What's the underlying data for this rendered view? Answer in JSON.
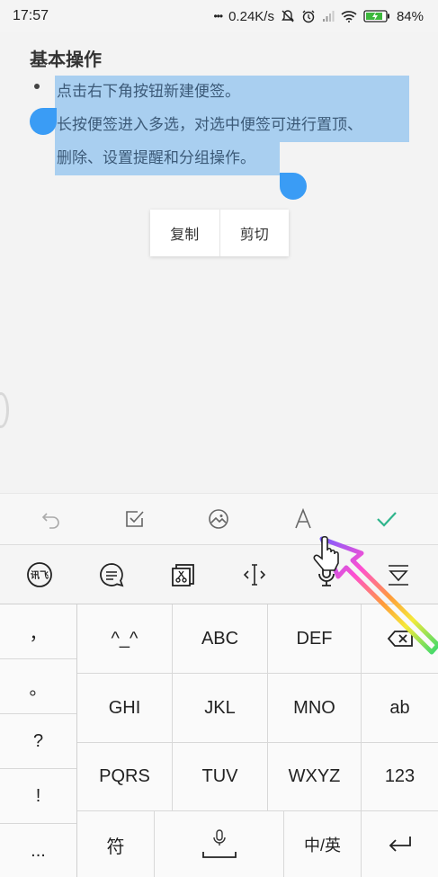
{
  "status_bar": {
    "time": "17:57",
    "dots": "•••",
    "net_speed": "0.24K/s",
    "battery": "84%",
    "icons": [
      "mute-icon",
      "alarm-icon",
      "signal-icon",
      "wifi-icon",
      "battery-charging-icon"
    ]
  },
  "note": {
    "heading": "基本操作",
    "lines": [
      "点击右下角按钮新建便签。",
      "长按便签进入多选，对选中便签可进行置顶、",
      "删除、设置提醒和分组操作。"
    ]
  },
  "context_menu": {
    "copy": "复制",
    "cut": "剪切"
  },
  "edit_toolbar": {
    "icons": [
      "undo-icon",
      "checkbox-icon",
      "image-icon",
      "font-icon",
      "check-icon"
    ],
    "accent": "#2fb58c"
  },
  "ime_toolbar": {
    "icons": [
      "ime-logo-icon",
      "clipboard-chat-icon",
      "edit-select-icon",
      "cursor-move-icon",
      "mic-icon",
      "hide-keyboard-icon"
    ]
  },
  "keyboard": {
    "punctuation": [
      "，",
      "。",
      "?",
      "!",
      "..."
    ],
    "row1": [
      "^_^",
      "ABC",
      "DEF"
    ],
    "row2": [
      "GHI",
      "JKL",
      "MNO",
      "ab"
    ],
    "row3": [
      "PQRS",
      "TUV",
      "WXYZ",
      "123"
    ],
    "symbol": "符",
    "zh_en": "中/英",
    "backspace": "backspace-icon",
    "space": "space-mic-icon",
    "enter": "enter-icon"
  },
  "colors": {
    "selection": "#a9cff0",
    "handle": "#3a9cf5"
  }
}
